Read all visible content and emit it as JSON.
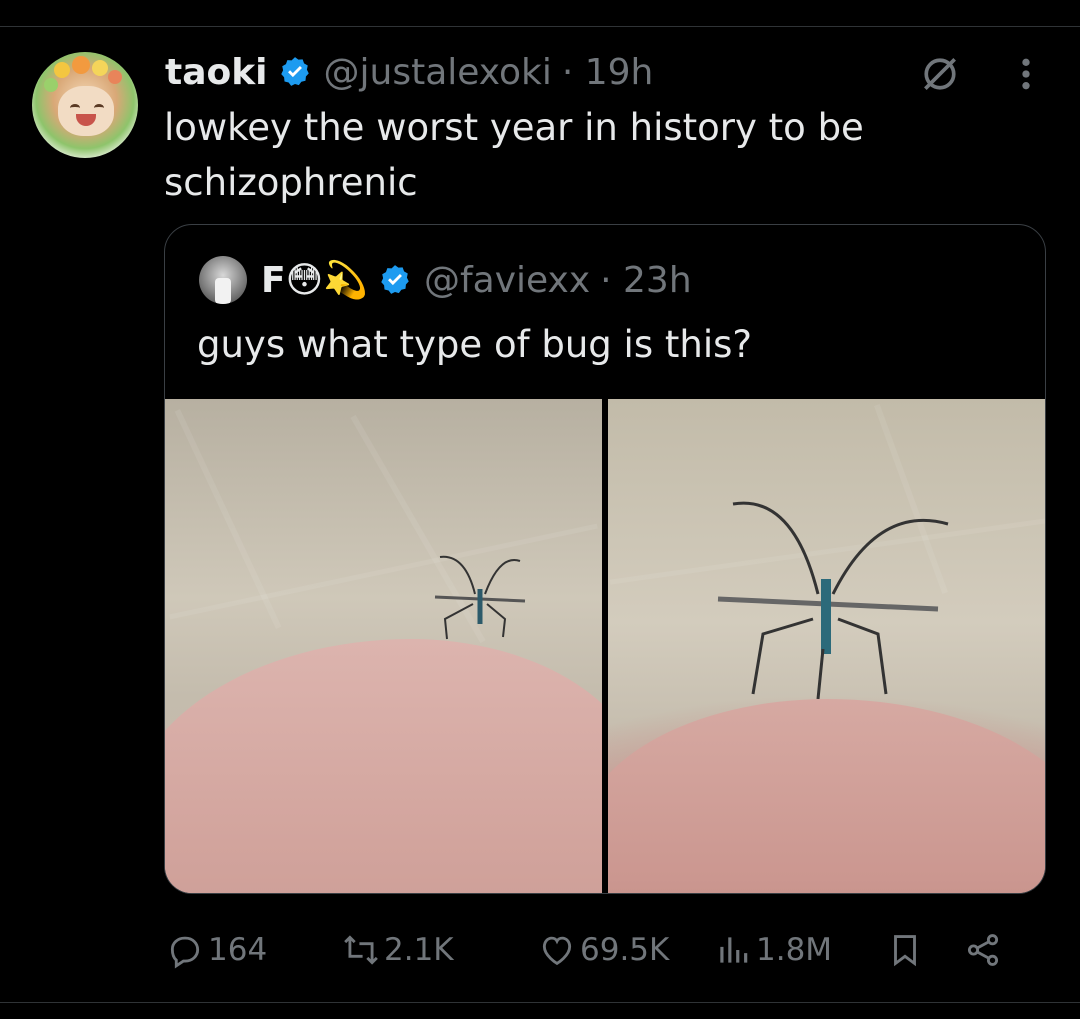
{
  "tweet": {
    "author_name": "taoki",
    "author_handle": "@justalexoki",
    "time": "· 19h",
    "text": "lowkey the worst year in history to be schizophrenic"
  },
  "quoted_tweet": {
    "author_name": "F😳💫",
    "author_handle": "@faviexx",
    "time": "· 23h",
    "text": "guys what type of bug is this?"
  },
  "actions": {
    "replies": "164",
    "reposts": "2.1K",
    "likes": "69.5K",
    "views": "1.8M"
  },
  "icons": [
    "grok-icon",
    "more-icon",
    "verified-icon",
    "reply-icon",
    "repost-icon",
    "like-icon",
    "views-icon",
    "bookmark-icon",
    "share-icon"
  ],
  "colors": {
    "background": "#000000",
    "verified": "#1d9bf0",
    "muted": "#71767b",
    "text": "#e7e9ea"
  }
}
